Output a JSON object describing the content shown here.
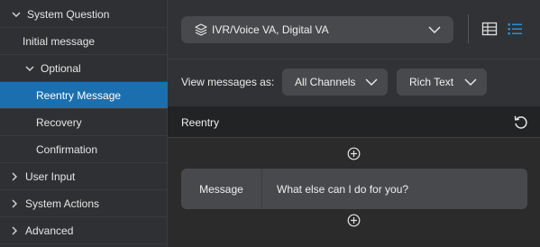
{
  "sidebar": {
    "items": [
      {
        "label": "System Question",
        "chevron": "chevron-down-icon"
      },
      {
        "label": "Initial message"
      },
      {
        "label": "Optional",
        "chevron": "chevron-down-icon"
      },
      {
        "label": "Reentry Message",
        "active": true
      },
      {
        "label": "Recovery"
      },
      {
        "label": "Confirmation"
      },
      {
        "label": "User Input",
        "chevron": "chevron-right-icon"
      },
      {
        "label": "System Actions",
        "chevron": "chevron-right-icon"
      },
      {
        "label": "Advanced",
        "chevron": "chevron-right-icon"
      }
    ]
  },
  "header": {
    "channel_select": {
      "value": "IVR/Voice VA, Digital VA",
      "icon": "layers-icon"
    },
    "view_toggle": {
      "table_icon": "table-view-icon",
      "list_icon": "list-view-icon",
      "active": "list"
    }
  },
  "view_bar": {
    "label": "View messages as:",
    "channels_value": "All Channels",
    "format_value": "Rich Text"
  },
  "section": {
    "title": "Reentry",
    "reset_icon": "reset-icon"
  },
  "message": {
    "label": "Message",
    "text": "What else can I do for you?"
  },
  "colors": {
    "active_bg": "#1b6fae",
    "accent_icon": "#2e8fd6",
    "panel_bg": "#2b2b2b",
    "control_bg": "#48494c"
  }
}
